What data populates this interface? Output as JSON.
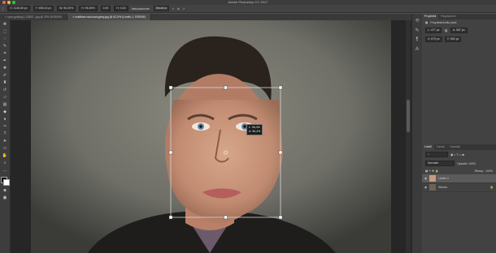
{
  "window": {
    "title": "Adobe Photoshop CC 2017",
    "traffic": [
      "#ff5f57",
      "#febc2e",
      "#28c840"
    ]
  },
  "options_bar": {
    "fields": [
      "X: 1145,50 px",
      "Y: 650,00 px",
      "W: 96,35%",
      "H: 96,35%",
      "0,00",
      "H: 0,00"
    ],
    "interpolation_label": "Interpolazione:",
    "interpolation_value": "Bicubica"
  },
  "document_tabs": [
    {
      "label": "ryan-gosling1-13553...jpg @ 33% (RGB/8*)",
      "active": false
    },
    {
      "label": "matthew-mcconaughey.jpg @ 62,5% (Livello 1, RGB/8*)",
      "active": true
    }
  ],
  "properties_panel": {
    "tabs": [
      "Proprietà",
      "Regolazioni"
    ],
    "subtitle": "Proprietà livello pixel",
    "w": "L: 477 px",
    "h": "A: 587 px",
    "x": "X: 879 px",
    "y": "Y: 550 px"
  },
  "layers_panel": {
    "tabs": [
      "Livelli",
      "Canali",
      "Tracciati"
    ],
    "blend_mode": "Normale",
    "opacity_label": "Opacità: 100%",
    "fill_label": "Riemp.: 100%",
    "layers": [
      {
        "name": "Livello 1",
        "selected": true
      },
      {
        "name": "Sfondo",
        "selected": false
      }
    ]
  },
  "canvas": {
    "tooltip": "L: 96,4%\nA: 96,4%"
  }
}
